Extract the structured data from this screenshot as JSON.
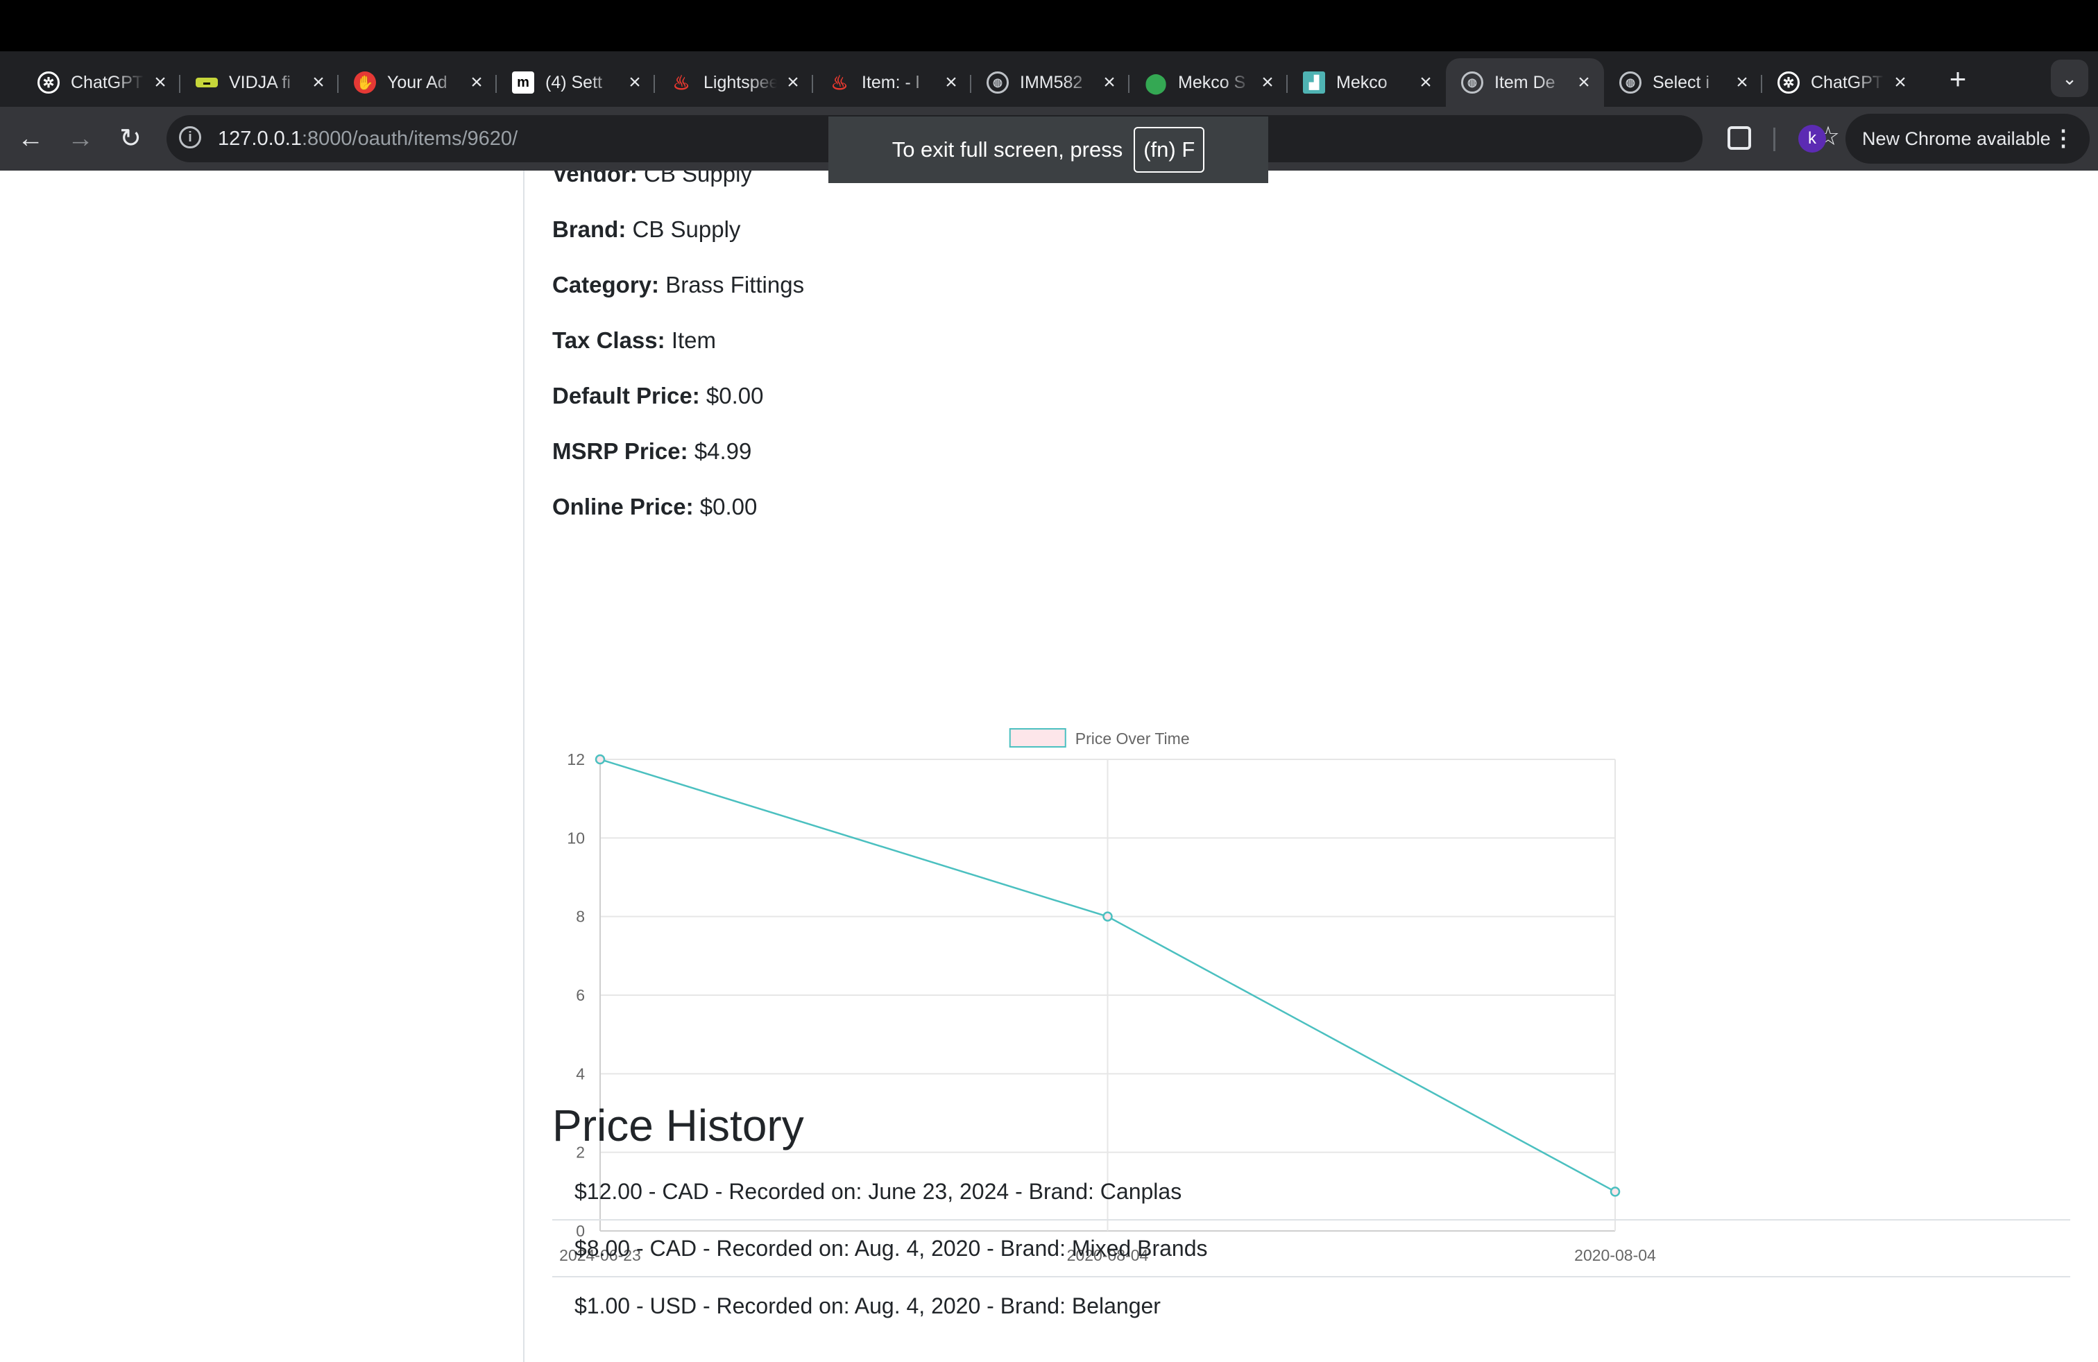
{
  "browser": {
    "tabs": [
      {
        "title": "ChatGPT",
        "favicon": "openai-icon",
        "color": "#ffffff"
      },
      {
        "title": "VIDJA fi",
        "favicon": "vidja-icon",
        "color": "#c6d63a"
      },
      {
        "title": "Your Ad",
        "favicon": "adblock-icon",
        "color": "#e53935"
      },
      {
        "title": "(4) Sett",
        "favicon": "m-icon",
        "color": "#ffffff"
      },
      {
        "title": "Lightspeed",
        "favicon": "lightspeed-flame-icon",
        "color": "#e8392f"
      },
      {
        "title": "Item: - l",
        "favicon": "lightspeed-flame-icon",
        "color": "#e8392f"
      },
      {
        "title": "IMM582",
        "favicon": "globe-icon",
        "color": "#bdc1c6"
      },
      {
        "title": "Mekco S",
        "favicon": "maps-pin-icon",
        "color": "#34a853"
      },
      {
        "title": "Mekco",
        "favicon": "mekco-icon",
        "color": "#4fb3b3"
      },
      {
        "title": "Item De",
        "favicon": "globe-icon",
        "color": "#bdc1c6"
      },
      {
        "title": "Select i",
        "favicon": "globe-icon",
        "color": "#bdc1c6"
      },
      {
        "title": "ChatGPT",
        "favicon": "openai-icon",
        "color": "#ffffff"
      }
    ],
    "active_tab_index": 9,
    "url_host": "127.0.0.1",
    "url_path": ":8000/oauth/items/9620/",
    "profile_initial": "k",
    "update_label": "New Chrome available",
    "fullscreen_toast": {
      "text": "To exit full screen, press",
      "key": "(fn) F"
    }
  },
  "item": {
    "fields": [
      {
        "label": "Vendor:",
        "value": "CB Supply"
      },
      {
        "label": "Brand:",
        "value": "CB Supply"
      },
      {
        "label": "Category:",
        "value": "Brass Fittings"
      },
      {
        "label": "Tax Class:",
        "value": "Item"
      },
      {
        "label": "Default Price:",
        "value": "$0.00"
      },
      {
        "label": "MSRP Price:",
        "value": "$4.99"
      },
      {
        "label": "Online Price:",
        "value": "$0.00"
      }
    ]
  },
  "chart_data": {
    "type": "line",
    "categories": [
      "2024-06-23",
      "2020-08-04",
      "2020-08-04"
    ],
    "series": [
      {
        "name": "Price Over Time",
        "values": [
          12,
          8,
          1
        ],
        "color": "#4bc0c0",
        "fill": "#fde6ea"
      }
    ],
    "yticks": [
      0,
      2,
      4,
      6,
      8,
      10,
      12
    ],
    "ylim": [
      0,
      12
    ],
    "grid": true,
    "legend": "top-center"
  },
  "price_history": {
    "title": "Price History",
    "entries": [
      "$12.00 - CAD - Recorded on: June 23, 2024 - Brand: Canplas",
      "$8.00 - CAD - Recorded on: Aug. 4, 2020 - Brand: Mixed Brands",
      "$1.00 - USD - Recorded on: Aug. 4, 2020 - Brand: Belanger"
    ]
  }
}
